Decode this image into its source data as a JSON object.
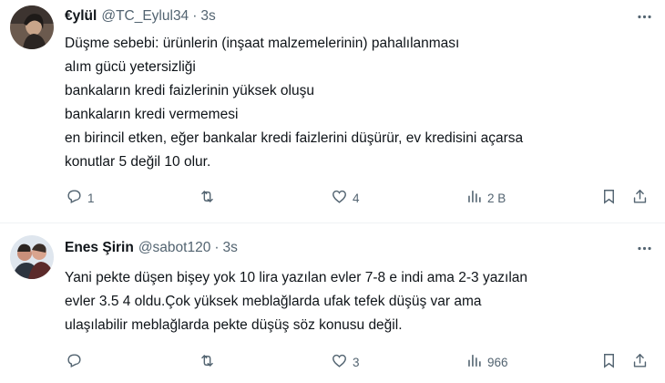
{
  "tweets": [
    {
      "name": "€ylül",
      "handle": "@TC_Eylul34",
      "separator": "·",
      "time": "3s",
      "lines": [
        "Düşme sebebi: ürünlerin (inşaat malzemelerinin) pahalılanması",
        "alım gücü yetersizliği",
        "bankaların kredi faizlerinin yüksek oluşu",
        "bankaların kredi vermemesi",
        "en birincil etken, eğer bankalar kredi faizlerini düşürür, ev kredisini açarsa",
        "konutlar  5 değil 10 olur."
      ],
      "replies": "1",
      "retweets": "",
      "likes": "4",
      "views": "2 B"
    },
    {
      "name": "Enes Şirin",
      "handle": "@sabot120",
      "separator": "·",
      "time": "3s",
      "lines": [
        "Yani pekte düşen bişey yok 10 lira yazılan evler 7-8 e indi ama 2-3 yazılan",
        "evler 3.5 4 oldu.Çok yüksek meblağlarda ufak tefek düşüş var ama",
        "ulaşılabilir meblağlarda pekte düşüş söz konusu değil."
      ],
      "replies": "",
      "retweets": "",
      "likes": "3",
      "views": "966"
    }
  ],
  "colors": {
    "text": "#0f1419",
    "secondary": "#536471",
    "divider": "#eff3f4"
  },
  "icons": [
    "more-icon",
    "reply-icon",
    "retweet-icon",
    "like-icon",
    "views-icon",
    "bookmark-icon",
    "share-icon"
  ]
}
